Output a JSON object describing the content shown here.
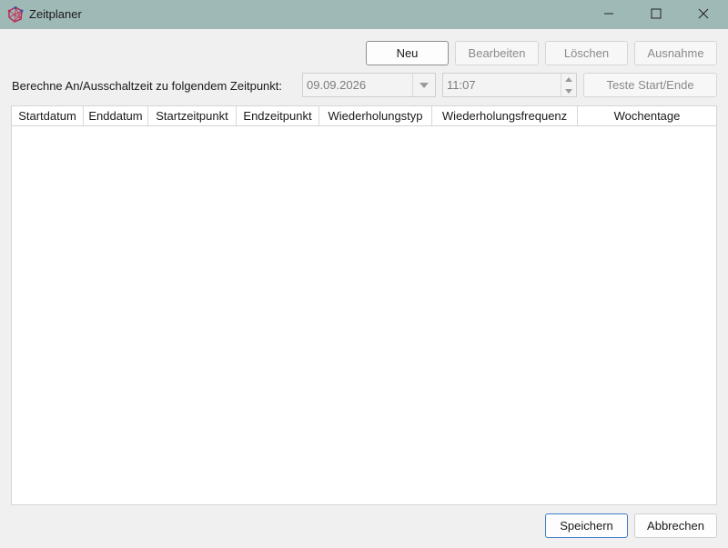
{
  "window": {
    "title": "Zeitplaner"
  },
  "toolbar": {
    "new_label": "Neu",
    "edit_label": "Bearbeiten",
    "delete_label": "Löschen",
    "exception_label": "Ausnahme"
  },
  "calc": {
    "label": "Berechne An/Ausschaltzeit zu folgendem Zeitpunkt:",
    "date_value": "09.09.2026",
    "time_value": "11:07",
    "test_button_label": "Teste Start/Ende"
  },
  "table": {
    "columns": [
      "Startdatum",
      "Enddatum",
      "Startzeitpunkt",
      "Endzeitpunkt",
      "Wiederholungstyp",
      "Wiederholungsfrequenz",
      "Wochentage"
    ],
    "rows": []
  },
  "footer": {
    "save_label": "Speichern",
    "cancel_label": "Abbrechen"
  },
  "icons": {
    "app": "app-logo-icon",
    "minimize": "minimize-icon",
    "maximize": "maximize-icon",
    "close": "close-icon",
    "dropdown": "chevron-down-icon",
    "spin_up": "spin-up-icon",
    "spin_down": "spin-down-icon"
  },
  "colors": {
    "titlebar": "#9fb9b6",
    "primary_border": "#3f7dc7"
  }
}
